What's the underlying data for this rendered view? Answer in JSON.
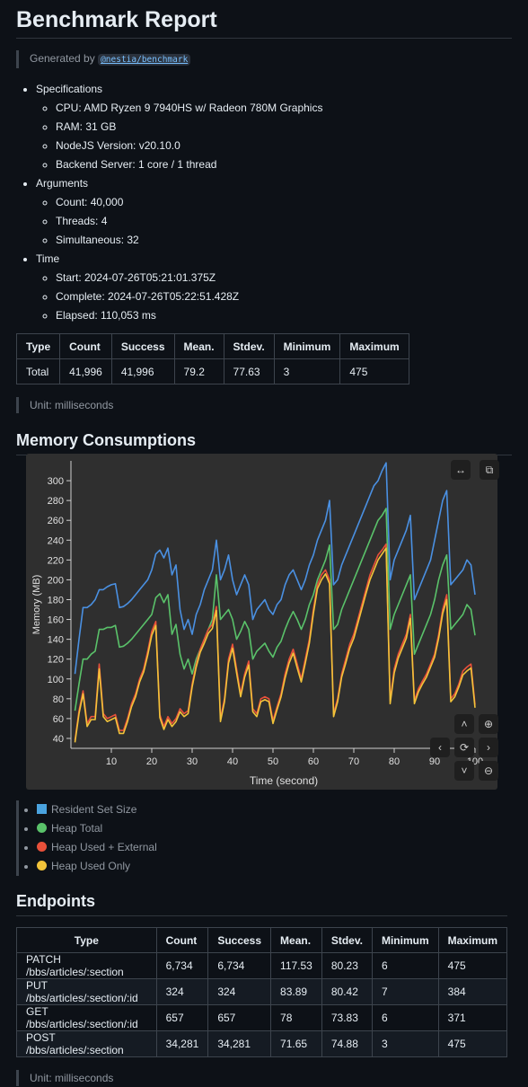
{
  "title": "Benchmark Report",
  "generated": {
    "prefix": "Generated by",
    "link": "@nestia/benchmark"
  },
  "spec": [
    {
      "label": "Specifications",
      "items": [
        "CPU: AMD Ryzen 9 7940HS w/ Radeon 780M Graphics",
        "RAM: 31 GB",
        "NodeJS Version: v20.10.0",
        "Backend Server: 1 core / 1 thread"
      ]
    },
    {
      "label": "Arguments",
      "items": [
        "Count: 40,000",
        "Threads: 4",
        "Simultaneous: 32"
      ]
    },
    {
      "label": "Time",
      "items": [
        "Start: 2024-07-26T05:21:01.375Z",
        "Complete: 2024-07-26T05:22:51.428Z",
        "Elapsed: 110,053 ms"
      ]
    }
  ],
  "summary": {
    "headers": [
      "Type",
      "Count",
      "Success",
      "Mean.",
      "Stdev.",
      "Minimum",
      "Maximum"
    ],
    "rows": [
      [
        "Total",
        "41,996",
        "41,996",
        "79.2",
        "77.63",
        "3",
        "475"
      ]
    ]
  },
  "unit": "Unit: milliseconds",
  "memory": {
    "heading": "Memory Consumptions",
    "controls": {
      "pan": "↔",
      "copy": "⧉",
      "zoom_in": "⊕",
      "zoom_out": "⊖",
      "up": "˄",
      "down": "˅",
      "left": "‹",
      "right": "›",
      "reset": "⟳"
    }
  },
  "chart_data": {
    "type": "line",
    "xlabel": "Time (second)",
    "ylabel": "Memory (MB)",
    "xlim": [
      0,
      100
    ],
    "ylim": [
      30,
      320
    ],
    "xticks": [
      10,
      20,
      30,
      40,
      50,
      60,
      70,
      80,
      90,
      100
    ],
    "xtick_labels": [
      "10",
      "20",
      "30",
      "40",
      "50",
      "60",
      "70",
      "80",
      "90",
      "100"
    ],
    "yticks": [
      40,
      60,
      80,
      100,
      120,
      140,
      160,
      180,
      200,
      220,
      240,
      260,
      280,
      300
    ],
    "x": [
      1,
      2,
      3,
      4,
      5,
      6,
      7,
      8,
      9,
      10,
      11,
      12,
      13,
      14,
      15,
      16,
      17,
      18,
      19,
      20,
      21,
      22,
      23,
      24,
      25,
      26,
      27,
      28,
      29,
      30,
      31,
      32,
      33,
      34,
      35,
      36,
      37,
      38,
      39,
      40,
      41,
      42,
      43,
      44,
      45,
      46,
      47,
      48,
      49,
      50,
      51,
      52,
      53,
      54,
      55,
      56,
      57,
      58,
      59,
      60,
      61,
      62,
      63,
      64,
      65,
      66,
      67,
      68,
      69,
      70,
      71,
      72,
      73,
      74,
      75,
      76,
      77,
      78,
      79,
      80,
      81,
      82,
      83,
      84,
      85,
      86,
      87,
      88,
      89,
      90,
      91,
      92,
      93,
      94,
      95,
      96,
      97,
      98,
      99,
      100
    ],
    "series": [
      {
        "name": "Resident Set Size",
        "color": "#4a90e2",
        "values": [
          105,
          140,
          172,
          172,
          175,
          180,
          190,
          190,
          193,
          195,
          196,
          172,
          173,
          176,
          180,
          185,
          190,
          195,
          200,
          210,
          226,
          230,
          222,
          232,
          205,
          215,
          170,
          150,
          160,
          145,
          165,
          175,
          190,
          200,
          210,
          240,
          200,
          210,
          225,
          200,
          185,
          195,
          205,
          195,
          160,
          170,
          175,
          180,
          170,
          165,
          175,
          180,
          195,
          205,
          210,
          200,
          190,
          200,
          215,
          225,
          240,
          250,
          260,
          280,
          195,
          200,
          215,
          225,
          235,
          245,
          255,
          265,
          275,
          285,
          295,
          300,
          310,
          318,
          200,
          220,
          230,
          240,
          250,
          265,
          180,
          190,
          200,
          210,
          220,
          240,
          260,
          280,
          290,
          195,
          200,
          205,
          210,
          220,
          215,
          185
        ]
      },
      {
        "name": "Heap Total",
        "color": "#5ac26a",
        "values": [
          68,
          95,
          120,
          120,
          125,
          128,
          150,
          150,
          152,
          152,
          154,
          132,
          133,
          136,
          140,
          145,
          150,
          155,
          160,
          165,
          182,
          186,
          177,
          185,
          145,
          155,
          125,
          110,
          120,
          105,
          120,
          130,
          140,
          150,
          160,
          205,
          160,
          165,
          170,
          160,
          140,
          148,
          158,
          150,
          120,
          128,
          132,
          136,
          128,
          122,
          132,
          138,
          150,
          160,
          168,
          160,
          150,
          160,
          175,
          185,
          200,
          210,
          220,
          235,
          150,
          155,
          170,
          180,
          190,
          200,
          210,
          220,
          230,
          240,
          250,
          260,
          265,
          272,
          150,
          165,
          175,
          185,
          195,
          205,
          125,
          135,
          145,
          155,
          165,
          180,
          200,
          215,
          225,
          150,
          155,
          160,
          165,
          175,
          170,
          144
        ]
      },
      {
        "name": "Heap Used + External",
        "color": "#e8503a",
        "values": [
          38,
          68,
          88,
          55,
          62,
          62,
          115,
          65,
          60,
          62,
          64,
          48,
          48,
          60,
          75,
          85,
          100,
          110,
          128,
          148,
          158,
          64,
          52,
          62,
          55,
          60,
          70,
          65,
          68,
          95,
          115,
          130,
          140,
          150,
          155,
          173,
          60,
          80,
          120,
          135,
          110,
          85,
          105,
          118,
          70,
          65,
          80,
          82,
          80,
          58,
          72,
          85,
          105,
          120,
          130,
          115,
          100,
          120,
          140,
          170,
          195,
          205,
          210,
          200,
          65,
          80,
          105,
          120,
          135,
          145,
          160,
          175,
          190,
          205,
          215,
          225,
          230,
          236,
          78,
          110,
          125,
          135,
          145,
          165,
          78,
          90,
          98,
          105,
          115,
          125,
          145,
          170,
          185,
          80,
          85,
          95,
          108,
          112,
          115,
          74
        ]
      },
      {
        "name": "Heap Used Only",
        "color": "#f2c33a",
        "values": [
          36,
          65,
          85,
          52,
          59,
          59,
          110,
          62,
          57,
          59,
          61,
          45,
          45,
          57,
          72,
          82,
          97,
          107,
          124,
          144,
          154,
          61,
          49,
          59,
          52,
          57,
          67,
          62,
          65,
          92,
          112,
          127,
          136,
          146,
          151,
          169,
          57,
          77,
          116,
          131,
          106,
          82,
          102,
          114,
          67,
          62,
          77,
          79,
          77,
          55,
          69,
          82,
          101,
          116,
          126,
          111,
          97,
          116,
          136,
          166,
          191,
          200,
          206,
          196,
          62,
          77,
          102,
          116,
          131,
          141,
          156,
          171,
          186,
          200,
          210,
          220,
          226,
          232,
          75,
          106,
          121,
          131,
          141,
          161,
          75,
          87,
          95,
          102,
          112,
          122,
          141,
          166,
          180,
          77,
          82,
          92,
          104,
          108,
          111,
          71
        ]
      }
    ]
  },
  "legend": [
    {
      "label": "Resident Set Size",
      "color": "#4aa3df",
      "shape": "square"
    },
    {
      "label": "Heap Total",
      "color": "#5ac26a",
      "shape": "circle"
    },
    {
      "label": "Heap Used + External",
      "color": "#e8503a",
      "shape": "circle"
    },
    {
      "label": "Heap Used Only",
      "color": "#f2c33a",
      "shape": "circle"
    }
  ],
  "endpoints": {
    "heading": "Endpoints",
    "headers": [
      "Type",
      "Count",
      "Success",
      "Mean.",
      "Stdev.",
      "Minimum",
      "Maximum"
    ],
    "rows": [
      [
        "PATCH /bbs/articles/:section",
        "6,734",
        "6,734",
        "117.53",
        "80.23",
        "6",
        "475"
      ],
      [
        "PUT /bbs/articles/:section/:id",
        "324",
        "324",
        "83.89",
        "80.42",
        "7",
        "384"
      ],
      [
        "GET /bbs/articles/:section/:id",
        "657",
        "657",
        "78",
        "73.83",
        "6",
        "371"
      ],
      [
        "POST /bbs/articles/:section",
        "34,281",
        "34,281",
        "71.65",
        "74.88",
        "3",
        "475"
      ]
    ]
  }
}
